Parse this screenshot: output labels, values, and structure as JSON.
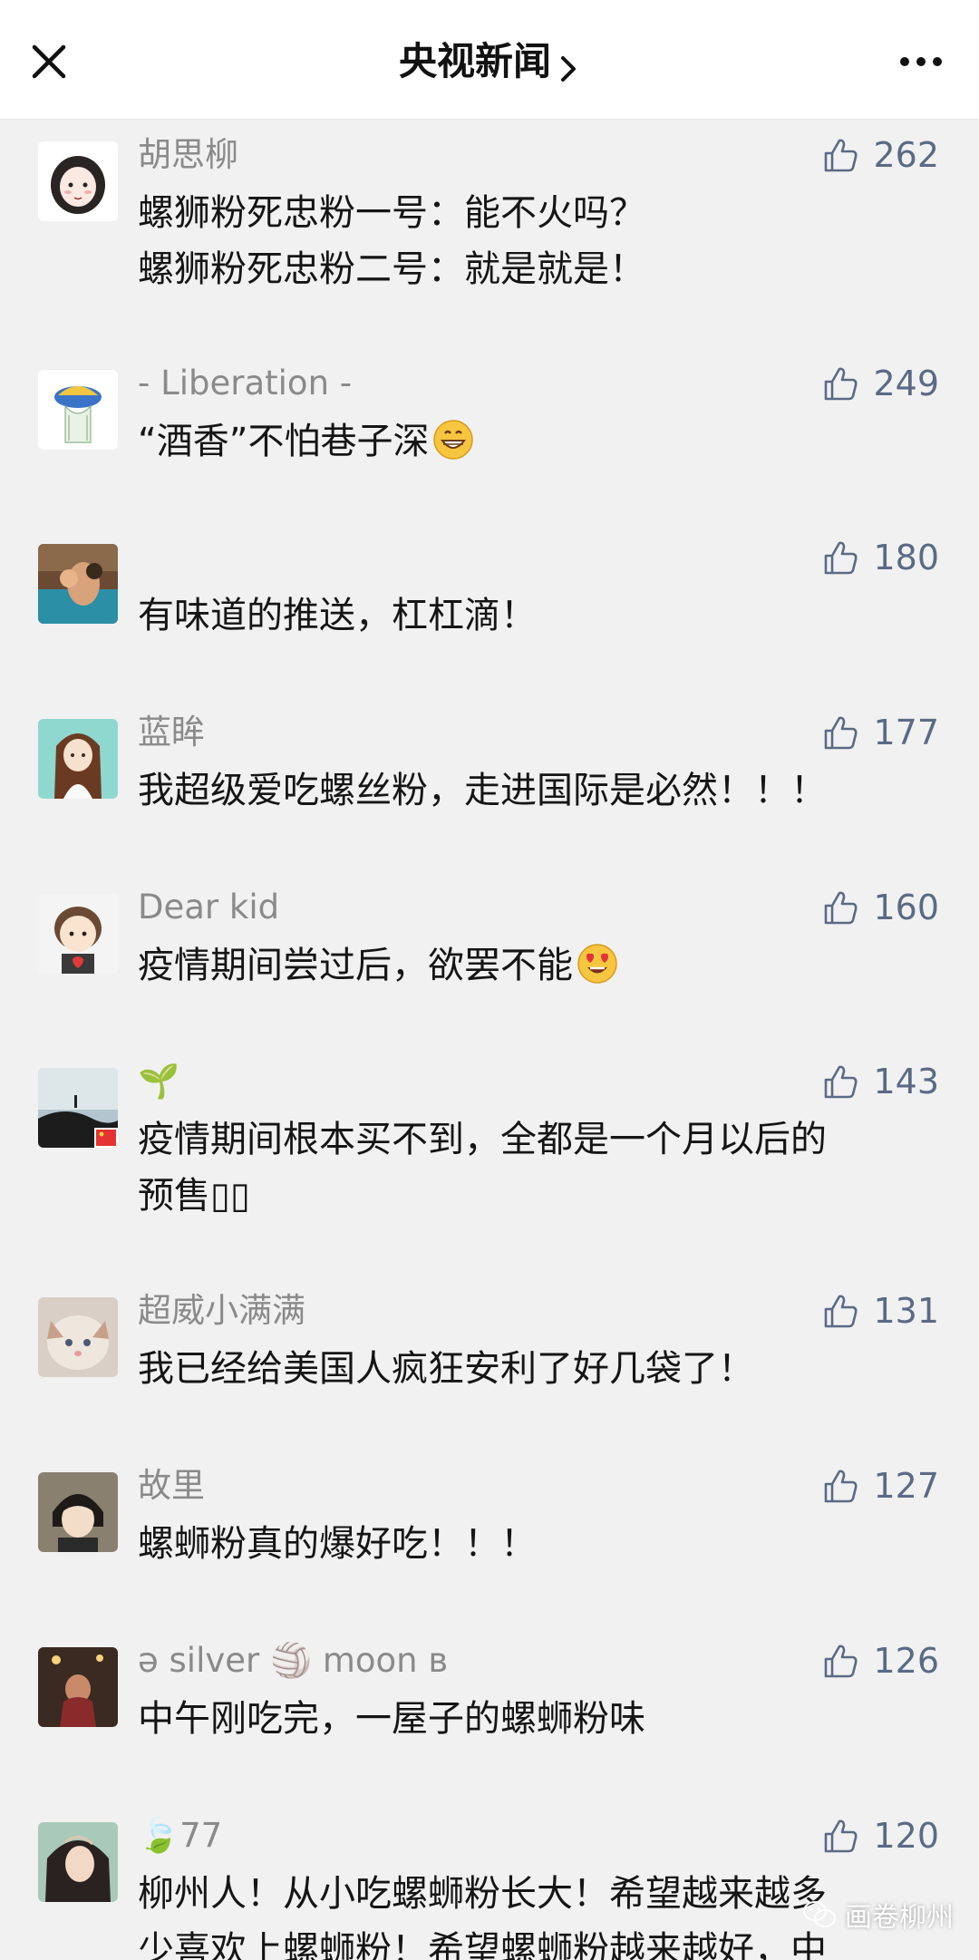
{
  "header": {
    "title": "央视新闻",
    "close_icon": "close-icon",
    "chevron_icon": "chevron-right-icon",
    "more_icon": "more-dots-icon"
  },
  "comments": [
    {
      "name": "胡思柳",
      "likes": "262",
      "text": "螺狮粉死忠粉一号：能不火吗？\n螺狮粉死忠粉二号：就是就是！",
      "emoji": ""
    },
    {
      "name": "- Liberation -",
      "likes": "249",
      "text": "“酒香”不怕巷子深",
      "emoji": "grinning-face-emoji"
    },
    {
      "name": "",
      "likes": "180",
      "text": "有味道的推送，杠杠滴！",
      "emoji": ""
    },
    {
      "name": "蓝眸",
      "likes": "177",
      "text": "我超级爱吃螺丝粉，走进国际是必然！！！",
      "emoji": ""
    },
    {
      "name": "Dear kid",
      "likes": "160",
      "text": "疫情期间尝过后，欲罢不能",
      "emoji": "heart-eyes-emoji"
    },
    {
      "name": "🌱",
      "likes": "143",
      "text": "疫情期间根本买不到，全都是一个月以后的\n预售▯▯",
      "emoji": ""
    },
    {
      "name": "超威小满满",
      "likes": "131",
      "text": "我已经给美国人疯狂安利了好几袋了！",
      "emoji": ""
    },
    {
      "name": "故里",
      "likes": "127",
      "text": "螺蛳粉真的爆好吃！！！",
      "emoji": ""
    },
    {
      "name": "ə silver 🏐 moon ʙ",
      "likes": "126",
      "text": "中午刚吃完，一屋子的螺蛳粉味",
      "emoji": ""
    },
    {
      "name": "🍃77",
      "likes": "120",
      "text": "柳州人！从小吃螺蛳粉长大！希望越来越多\n少喜欢上螺蛳粉！希望螺蛳粉越来越好，中",
      "emoji": ""
    }
  ],
  "watermark": {
    "text": "画卷柳州",
    "icon": "wechat-logo-icon"
  },
  "colors": {
    "background": "#f1f1f1",
    "header_bg": "#ffffff",
    "name": "#8a8a8a",
    "like": "#5a6a86",
    "text": "#151515"
  }
}
